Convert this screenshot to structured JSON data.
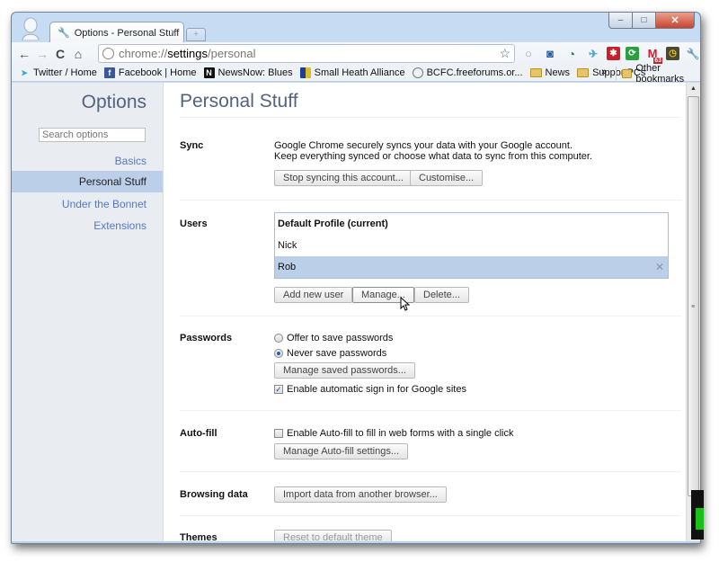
{
  "window": {
    "controls": {
      "minimize": "–",
      "maximize": "□",
      "close": "✕"
    }
  },
  "tab": {
    "icon": "wrench-icon",
    "title": "Options - Personal Stuff",
    "close": "×",
    "new_tab": "+"
  },
  "toolbar": {
    "back": "←",
    "forward": "→",
    "reload": "C",
    "home": "⌂",
    "url_scheme": "chrome://",
    "url_host": "settings",
    "url_path": "/personal",
    "star": "☆",
    "extensions": [
      {
        "name": "search-extension-icon",
        "glyph": "○",
        "color": "#9aa0a8"
      },
      {
        "name": "camera-extension-icon",
        "glyph": "◙",
        "color": "#2a5aa0"
      },
      {
        "name": "clock-extension-icon",
        "glyph": "◔",
        "color": "#3a7a55"
      },
      {
        "name": "bird-extension-icon",
        "glyph": "✈",
        "color": "#4aa4e0"
      },
      {
        "name": "lastpass-extension-icon",
        "glyph": "✱",
        "color": "#c8202a"
      },
      {
        "name": "sync-extension-icon",
        "glyph": "⟳",
        "color": "#2aa040"
      },
      {
        "name": "gmail-extension-icon",
        "glyph": "M",
        "color": "#d0222a",
        "badge": "63"
      },
      {
        "name": "speed-extension-icon",
        "glyph": "◷",
        "color": "#5a5a3a"
      }
    ],
    "menu": "wrench-menu-icon"
  },
  "bookmarks": {
    "items": [
      {
        "label": "Twitter / Home",
        "icon": "twitter-icon"
      },
      {
        "label": "Facebook | Home",
        "icon": "facebook-icon"
      },
      {
        "label": "NewsNow: Blues",
        "icon": "newsnow-icon"
      },
      {
        "label": "Small Heath Alliance",
        "icon": "sha-icon"
      },
      {
        "label": "BCFC.freeforums.or...",
        "icon": "globe-icon"
      },
      {
        "label": "News",
        "icon": "folder-icon"
      },
      {
        "label": "SupportPCs",
        "icon": "folder-icon"
      }
    ],
    "more": "»",
    "other": "Other bookmarks"
  },
  "sidebar": {
    "title": "Options",
    "search_placeholder": "Search options",
    "items": [
      {
        "label": "Basics",
        "selected": false
      },
      {
        "label": "Personal Stuff",
        "selected": true
      },
      {
        "label": "Under the Bonnet",
        "selected": false
      },
      {
        "label": "Extensions",
        "selected": false
      }
    ]
  },
  "main": {
    "title": "Personal Stuff",
    "sync": {
      "label": "Sync",
      "line1": "Google Chrome securely syncs your data with your Google account.",
      "line2": "Keep everything synced or choose what data to sync from this computer.",
      "stop_button": "Stop syncing this account...",
      "customise_button": "Customise..."
    },
    "users": {
      "label": "Users",
      "list": [
        {
          "name": "Default Profile (current)",
          "current": true,
          "selected": false
        },
        {
          "name": "Nick",
          "current": false,
          "selected": false
        },
        {
          "name": "Rob",
          "current": false,
          "selected": true
        }
      ],
      "delete_glyph": "✕",
      "add_button": "Add new user",
      "manage_button": "Manage...",
      "delete_button": "Delete..."
    },
    "passwords": {
      "label": "Passwords",
      "offer": {
        "label": "Offer to save passwords",
        "checked": false
      },
      "never": {
        "label": "Never save passwords",
        "checked": true
      },
      "manage_button": "Manage saved passwords...",
      "auto_signin": {
        "label": "Enable automatic sign in for Google sites",
        "checked": true
      }
    },
    "autofill": {
      "label": "Auto-fill",
      "enable": {
        "label": "Enable Auto-fill to fill in web forms with a single click",
        "checked": false
      },
      "manage_button": "Manage Auto-fill settings..."
    },
    "browsing": {
      "label": "Browsing data",
      "import_button": "Import data from another browser..."
    },
    "themes": {
      "label": "Themes",
      "reset_button": "Reset to default theme"
    }
  },
  "scrollbar": {
    "up": "▲",
    "down": "▼",
    "grip": "≡"
  }
}
